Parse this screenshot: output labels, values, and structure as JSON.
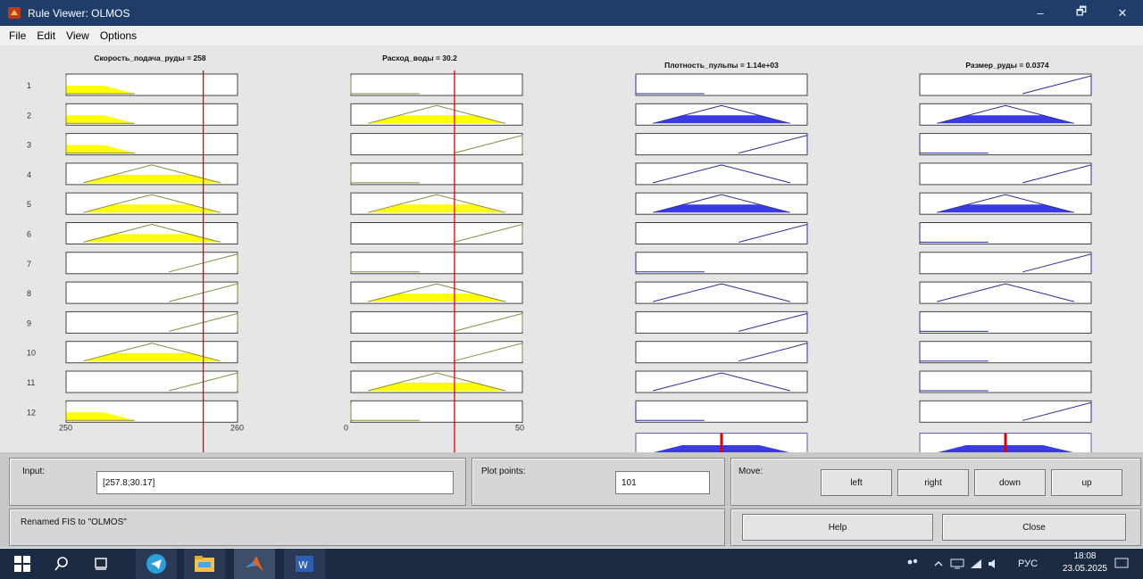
{
  "window": {
    "title": "Rule Viewer: OLMOS",
    "controls": {
      "minimize": "–",
      "maximize": "🗗",
      "close": "✕"
    }
  },
  "menu": [
    "File",
    "Edit",
    "View",
    "Options"
  ],
  "columns": [
    {
      "header": "Скорость_подача_руды = 258",
      "kind": "input",
      "range_labels": [
        "250",
        "260"
      ]
    },
    {
      "header": "Расход_воды = 30.2",
      "kind": "input",
      "range_labels": [
        "0",
        "50"
      ]
    },
    {
      "header": "Плотность_пульпы = 1.14e+03",
      "kind": "output"
    },
    {
      "header": "Размер_руды = 0.0374",
      "kind": "output"
    }
  ],
  "row_numbers": [
    "1",
    "2",
    "3",
    "4",
    "5",
    "6",
    "7",
    "8",
    "9",
    "10",
    "11",
    "12"
  ],
  "input_values": [
    258,
    30.2
  ],
  "input_ranges": [
    [
      250,
      260
    ],
    [
      0,
      50
    ]
  ],
  "colors": {
    "input_fill": "#ffff00",
    "output_fill": "#3a3ae6",
    "indicator": "#e00000",
    "taskbar": "#1d2b42"
  },
  "input_panel": {
    "label": "Input:",
    "value": "[257.8;30.17]"
  },
  "plot_points": {
    "label": "Plot points:",
    "value": "101"
  },
  "move": {
    "label": "Move:",
    "buttons": [
      "left",
      "right",
      "down",
      "up"
    ]
  },
  "status": "Renamed FIS to \"OLMOS\"",
  "actions": {
    "help": "Help",
    "close": "Close"
  },
  "taskbar": {
    "lang": "РУС",
    "time": "18:08",
    "date": "23.05.2025",
    "icons": [
      "windows-start-icon",
      "search-icon",
      "task-view-icon",
      "telegram-icon",
      "file-explorer-icon",
      "matlab-icon",
      "word-icon"
    ]
  }
}
